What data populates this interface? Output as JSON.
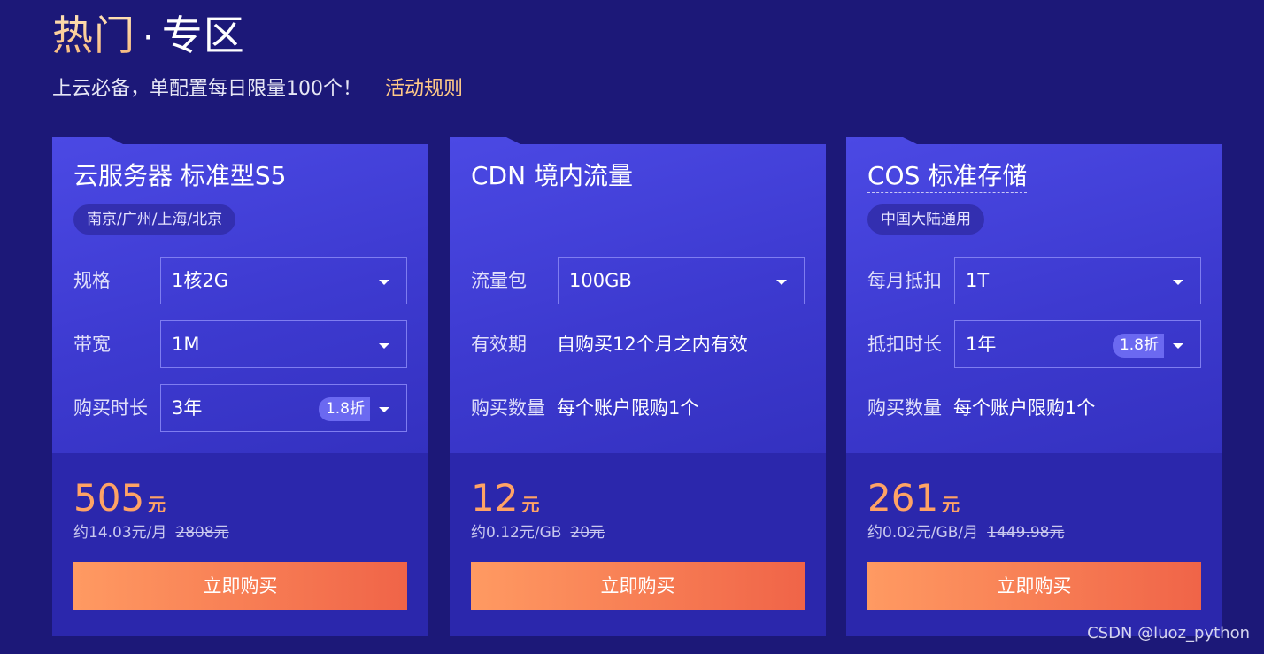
{
  "header": {
    "title_hot": "热门",
    "title_sep": "·",
    "title_zone": "专区",
    "subtitle": "上云必备，单配置每日限量100个！",
    "rules_link": "活动规则"
  },
  "cards": [
    {
      "title": "云服务器 标准型S5",
      "region": "南京/广州/上海/北京",
      "rows": [
        {
          "label": "规格",
          "value": "1核2G"
        },
        {
          "label": "带宽",
          "value": "1M"
        },
        {
          "label": "购买时长",
          "value": "3年",
          "badge": "1.8折"
        }
      ],
      "price": "505",
      "price_unit": "元",
      "price_per": "约14.03元/月",
      "price_original": "2808元",
      "buy_label": "立即购买"
    },
    {
      "title": "CDN 境内流量",
      "rows": [
        {
          "label": "流量包",
          "value": "100GB"
        },
        {
          "label": "有效期",
          "value": "自购买12个月之内有效"
        },
        {
          "label": "购买数量",
          "value": "每个账户限购1个"
        }
      ],
      "price": "12",
      "price_unit": "元",
      "price_per": "约0.12元/GB",
      "price_original": "20元",
      "buy_label": "立即购买"
    },
    {
      "title": "COS 标准存储",
      "region": "中国大陆通用",
      "rows": [
        {
          "label": "每月抵扣",
          "value": "1T"
        },
        {
          "label": "抵扣时长",
          "value": "1年",
          "badge": "1.8折"
        },
        {
          "label": "购买数量",
          "value": "每个账户限购1个"
        }
      ],
      "price": "261",
      "price_unit": "元",
      "price_per": "约0.02元/GB/月",
      "price_original": "1449.98元",
      "buy_label": "立即购买"
    }
  ],
  "watermark": "CSDN @luoz_python",
  "colors": {
    "background": "#1c1878",
    "card_top": "#4442db",
    "card_bottom": "#2b27ac",
    "price": "#ffa365",
    "accent_link": "#ffc987",
    "button_start": "#ff9a62",
    "button_end": "#f06448"
  }
}
